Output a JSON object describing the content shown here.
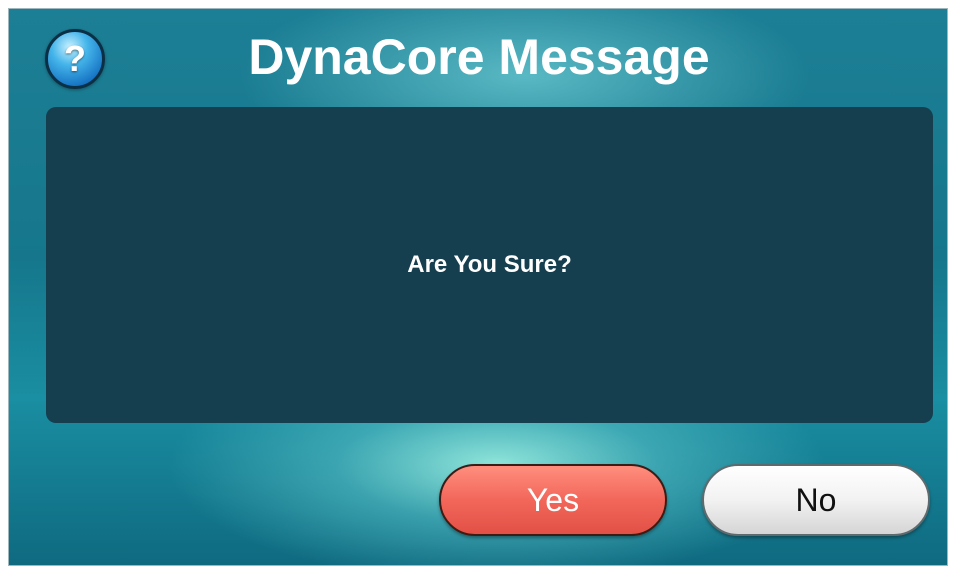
{
  "dialog": {
    "title": "DynaCore Message",
    "help_icon_glyph": "?",
    "message": "Are You Sure?"
  },
  "buttons": {
    "yes_label": "Yes",
    "no_label": "No"
  },
  "colors": {
    "panel_background": "#153e4e",
    "yes_button": "#f2675a",
    "no_button": "#f2f2f2",
    "help_icon": "#1877c5"
  }
}
